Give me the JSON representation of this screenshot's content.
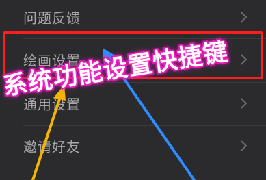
{
  "menu": {
    "items": [
      {
        "label": "问题反馈"
      },
      {
        "label": "绘画设置"
      },
      {
        "label": "通用设置"
      },
      {
        "label": "邀请好友"
      }
    ]
  },
  "annotation": {
    "banner_text": "系统功能设置快捷键",
    "highlight_color": "#ff1d1d",
    "banner_glow_color": "#ff2bd6",
    "arrow_colors": {
      "yellow": "#f5b400",
      "blue": "#2f8cff"
    }
  }
}
